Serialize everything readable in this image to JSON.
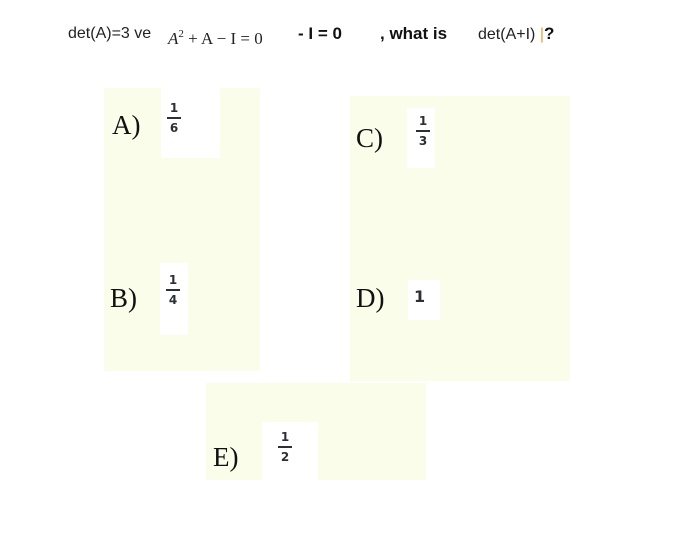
{
  "question": {
    "given_prefix": "det(A)=3 ve ",
    "equation": {
      "base": "A",
      "exponent": "2",
      "rest": " + A − I = 0"
    },
    "equation_plain": " - I = 0",
    "ask": ", what is",
    "target": "det(A+I)",
    "cursor": "|",
    "question_mark": "?"
  },
  "options": [
    {
      "letter": "A)",
      "numerator": "1",
      "denominator": "6"
    },
    {
      "letter": "B)",
      "numerator": "1",
      "denominator": "4"
    },
    {
      "letter": "C)",
      "numerator": "1",
      "denominator": "3"
    },
    {
      "letter": "D)",
      "value": "1"
    },
    {
      "letter": "E)",
      "numerator": "1",
      "denominator": "2"
    }
  ],
  "colors": {
    "panel_background": "#fafdea",
    "cursor": "#e8a33c"
  }
}
